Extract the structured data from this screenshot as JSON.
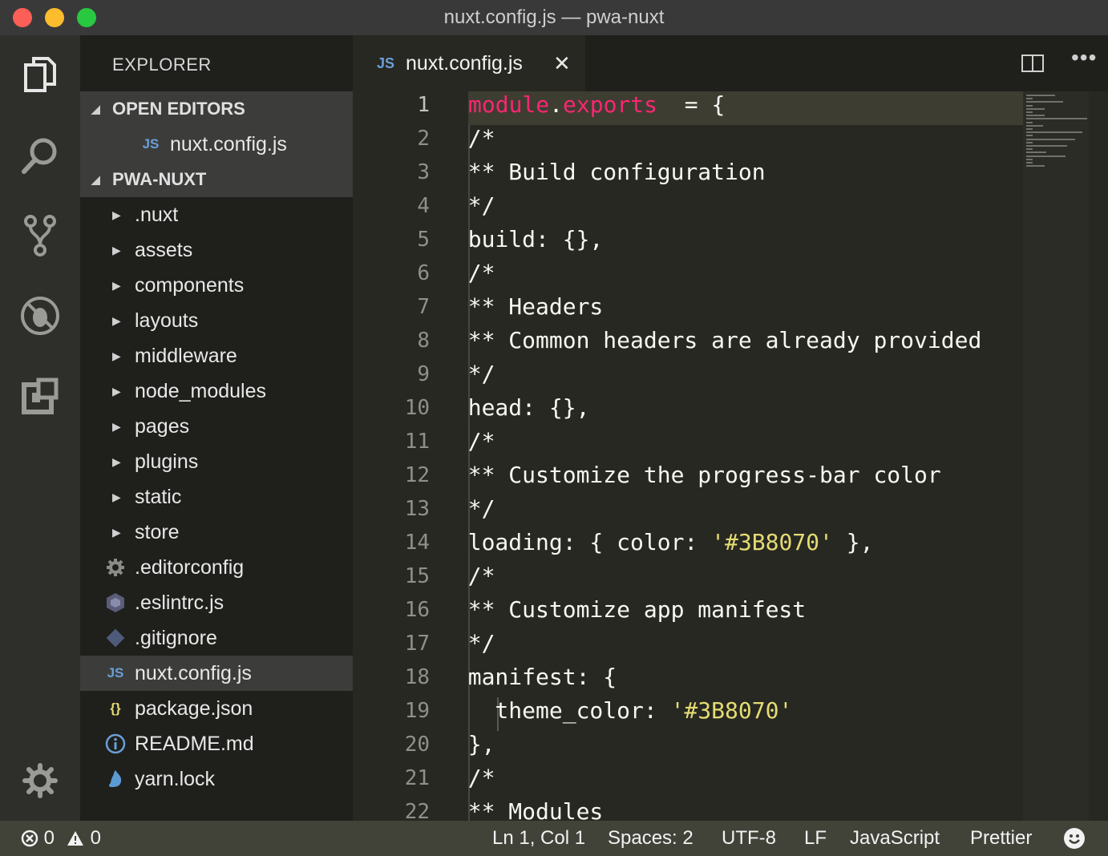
{
  "window": {
    "title": "nuxt.config.js — pwa-nuxt"
  },
  "activity_bar": {
    "icons": [
      "files-icon",
      "search-icon",
      "source-control-icon",
      "debug-icon",
      "extensions-icon",
      "settings-gear-icon"
    ]
  },
  "sidebar": {
    "title": "EXPLORER",
    "open_editors": {
      "header": "OPEN EDITORS",
      "items": [
        {
          "badge": "JS",
          "label": "nuxt.config.js"
        }
      ]
    },
    "project": {
      "header": "PWA-NUXT",
      "folders": [
        ".nuxt",
        "assets",
        "components",
        "layouts",
        "middleware",
        "node_modules",
        "pages",
        "plugins",
        "static",
        "store"
      ],
      "files": [
        {
          "icon": "gear-icon",
          "label": ".editorconfig"
        },
        {
          "icon": "eslint-icon",
          "label": ".eslintrc.js"
        },
        {
          "icon": "git-icon",
          "label": ".gitignore"
        },
        {
          "icon": "js-icon",
          "badge": "JS",
          "label": "nuxt.config.js",
          "selected": true
        },
        {
          "icon": "json-icon",
          "badge": "{}",
          "label": "package.json"
        },
        {
          "icon": "info-icon",
          "label": "README.md"
        },
        {
          "icon": "yarn-icon",
          "label": "yarn.lock"
        }
      ]
    }
  },
  "editor": {
    "tab": {
      "badge": "JS",
      "label": "nuxt.config.js",
      "close": "✕"
    },
    "actions": {
      "more": "•••"
    },
    "lines": [
      {
        "n": "1",
        "tokens": [
          [
            "kw",
            "module"
          ],
          [
            "dot",
            "."
          ],
          [
            "kw",
            "exports"
          ],
          [
            "",
            "  = {"
          ]
        ]
      },
      {
        "n": "2",
        "tokens": [
          [
            "",
            "  /*"
          ]
        ]
      },
      {
        "n": "3",
        "tokens": [
          [
            "",
            "  ** Build configuration"
          ]
        ]
      },
      {
        "n": "4",
        "tokens": [
          [
            "",
            "  */"
          ]
        ]
      },
      {
        "n": "5",
        "tokens": [
          [
            "",
            "  build: {},"
          ]
        ]
      },
      {
        "n": "6",
        "tokens": [
          [
            "",
            "  /*"
          ]
        ]
      },
      {
        "n": "7",
        "tokens": [
          [
            "",
            "  ** Headers"
          ]
        ]
      },
      {
        "n": "8",
        "tokens": [
          [
            "",
            "  ** Common headers are already provided"
          ]
        ]
      },
      {
        "n": "9",
        "tokens": [
          [
            "",
            "  */"
          ]
        ]
      },
      {
        "n": "10",
        "tokens": [
          [
            "",
            "  head: {},"
          ]
        ]
      },
      {
        "n": "11",
        "tokens": [
          [
            "",
            "  /*"
          ]
        ]
      },
      {
        "n": "12",
        "tokens": [
          [
            "",
            "  ** Customize the progress-bar color"
          ]
        ]
      },
      {
        "n": "13",
        "tokens": [
          [
            "",
            "  */"
          ]
        ]
      },
      {
        "n": "14",
        "tokens": [
          [
            "",
            "  loading: { color: "
          ],
          [
            "str",
            "'#3B8070'"
          ],
          [
            "",
            " },"
          ]
        ]
      },
      {
        "n": "15",
        "tokens": [
          [
            "",
            "  /*"
          ]
        ]
      },
      {
        "n": "16",
        "tokens": [
          [
            "",
            "  ** Customize app manifest"
          ]
        ]
      },
      {
        "n": "17",
        "tokens": [
          [
            "",
            "  */"
          ]
        ]
      },
      {
        "n": "18",
        "tokens": [
          [
            "",
            "  manifest: {"
          ]
        ]
      },
      {
        "n": "19",
        "tokens": [
          [
            "",
            "    theme_color: "
          ],
          [
            "str",
            "'#3B8070'"
          ]
        ]
      },
      {
        "n": "20",
        "tokens": [
          [
            "",
            "  },"
          ]
        ]
      },
      {
        "n": "21",
        "tokens": [
          [
            "",
            "  /*"
          ]
        ]
      },
      {
        "n": "22",
        "tokens": [
          [
            "",
            "  ** Modules"
          ]
        ]
      }
    ]
  },
  "status_bar": {
    "errors": "0",
    "warnings": "0",
    "position": "Ln 1, Col 1",
    "spaces": "Spaces: 2",
    "encoding": "UTF-8",
    "eol": "LF",
    "language": "JavaScript",
    "formatter": "Prettier"
  },
  "colors": {
    "keyword": "#f92672",
    "string": "#e6db74",
    "background": "#272822",
    "sidebar": "#1f201c",
    "statusbar": "#414339"
  }
}
